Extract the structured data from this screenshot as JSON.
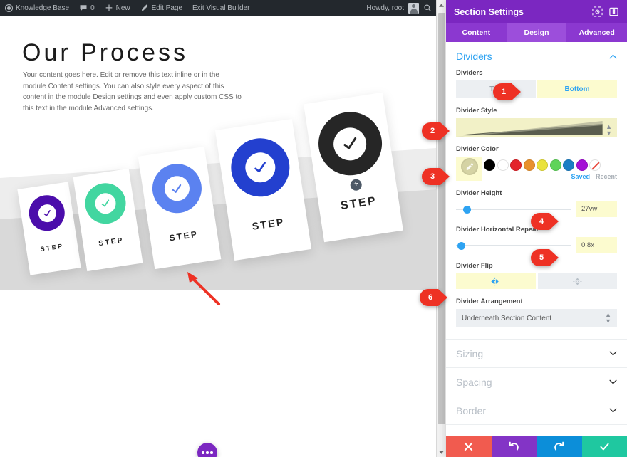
{
  "adminbar": {
    "logo_icon": "wordpress-logo-icon",
    "site_name": "Knowledge Base",
    "comments_icon": "comment-bubble-icon",
    "comments_count": "0",
    "new_icon": "plus-icon",
    "new_label": "New",
    "edit_icon": "pencil-icon",
    "edit_label": "Edit Page",
    "exit_label": "Exit Visual Builder",
    "howdy": "Howdy, root",
    "avatar_icon": "user-avatar",
    "search_icon": "search-icon"
  },
  "page": {
    "title": "Our Process",
    "body": "Your content goes here. Edit or remove this text inline or in the module Content settings. You can also style every aspect of this content in the module Design settings and even apply custom CSS to this text in the module Advanced settings.",
    "divider_color": "#d6d6d6",
    "divider_band_color": "#e8e8e8",
    "add_module_icon": "plus-icon",
    "fab_icon": "ellipsis-icon",
    "annotation_arrow_icon": "red-arrow-icon",
    "steps": [
      {
        "label": "STEP",
        "color": "#4b0dab"
      },
      {
        "label": "STEP",
        "color": "#42d6a0"
      },
      {
        "label": "STEP",
        "color": "#5b82f0"
      },
      {
        "label": "STEP",
        "color": "#2340cf"
      },
      {
        "label": "STEP",
        "color": "#262626"
      }
    ]
  },
  "scrollbar": {
    "up_icon": "caret-up-icon",
    "down_icon": "caret-down-icon"
  },
  "panel": {
    "title": "Section Settings",
    "header_icons": [
      "target-icon",
      "layout-split-icon"
    ],
    "tabs": [
      {
        "label": "Content",
        "active": false
      },
      {
        "label": "Design",
        "active": true
      },
      {
        "label": "Advanced",
        "active": false
      }
    ],
    "section": {
      "name": "Dividers",
      "collapse_icon": "chevron-up-icon"
    },
    "fields": {
      "dividers": {
        "label": "Dividers",
        "options": [
          "Top",
          "Bottom"
        ],
        "selected": "Bottom"
      },
      "divider_style": {
        "label": "Divider Style",
        "select_icon": "select-arrows-icon"
      },
      "divider_color": {
        "label": "Divider Color",
        "picker_icon": "eyedropper-icon",
        "more_icon": "ellipsis-icon",
        "swatches": [
          "#000000",
          "#ffffff",
          "#e3242b",
          "#e8912d",
          "#eae23c",
          "#5fd45a",
          "#1b7fc4",
          "#a411d6"
        ],
        "none_swatch": "none",
        "saved_label": "Saved",
        "recent_label": "Recent"
      },
      "divider_height": {
        "label": "Divider Height",
        "value": "27vw",
        "knob_percent": 6
      },
      "divider_horizontal_repeat": {
        "label": "Divider Horizontal Repeat",
        "value": "0.8x",
        "knob_percent": 2
      },
      "divider_flip": {
        "label": "Divider Flip",
        "options": [
          {
            "icon": "flip-horizontal-icon",
            "active": true
          },
          {
            "icon": "flip-vertical-icon",
            "active": false
          }
        ]
      },
      "divider_arrangement": {
        "label": "Divider Arrangement",
        "value": "Underneath Section Content",
        "select_icon": "select-arrows-icon"
      }
    },
    "accordions": [
      {
        "label": "Sizing",
        "icon": "chevron-down-icon"
      },
      {
        "label": "Spacing",
        "icon": "chevron-down-icon"
      },
      {
        "label": "Border",
        "icon": "chevron-down-icon"
      }
    ],
    "footer": [
      {
        "name": "cancel",
        "icon": "close-x-icon",
        "color": "#f15b4f"
      },
      {
        "name": "undo",
        "icon": "undo-arrow-icon",
        "color": "#8334c6"
      },
      {
        "name": "redo",
        "icon": "redo-arrow-icon",
        "color": "#0c8ed9"
      },
      {
        "name": "save",
        "icon": "check-icon",
        "color": "#1fc8a0"
      }
    ]
  },
  "callouts": [
    {
      "n": "1",
      "target": "dividers-bottom-toggle"
    },
    {
      "n": "2",
      "target": "divider-style-select"
    },
    {
      "n": "3",
      "target": "divider-color-picker"
    },
    {
      "n": "4",
      "target": "divider-height-value"
    },
    {
      "n": "5",
      "target": "divider-horizontal-repeat-value"
    },
    {
      "n": "6",
      "target": "divider-flip-group"
    }
  ]
}
